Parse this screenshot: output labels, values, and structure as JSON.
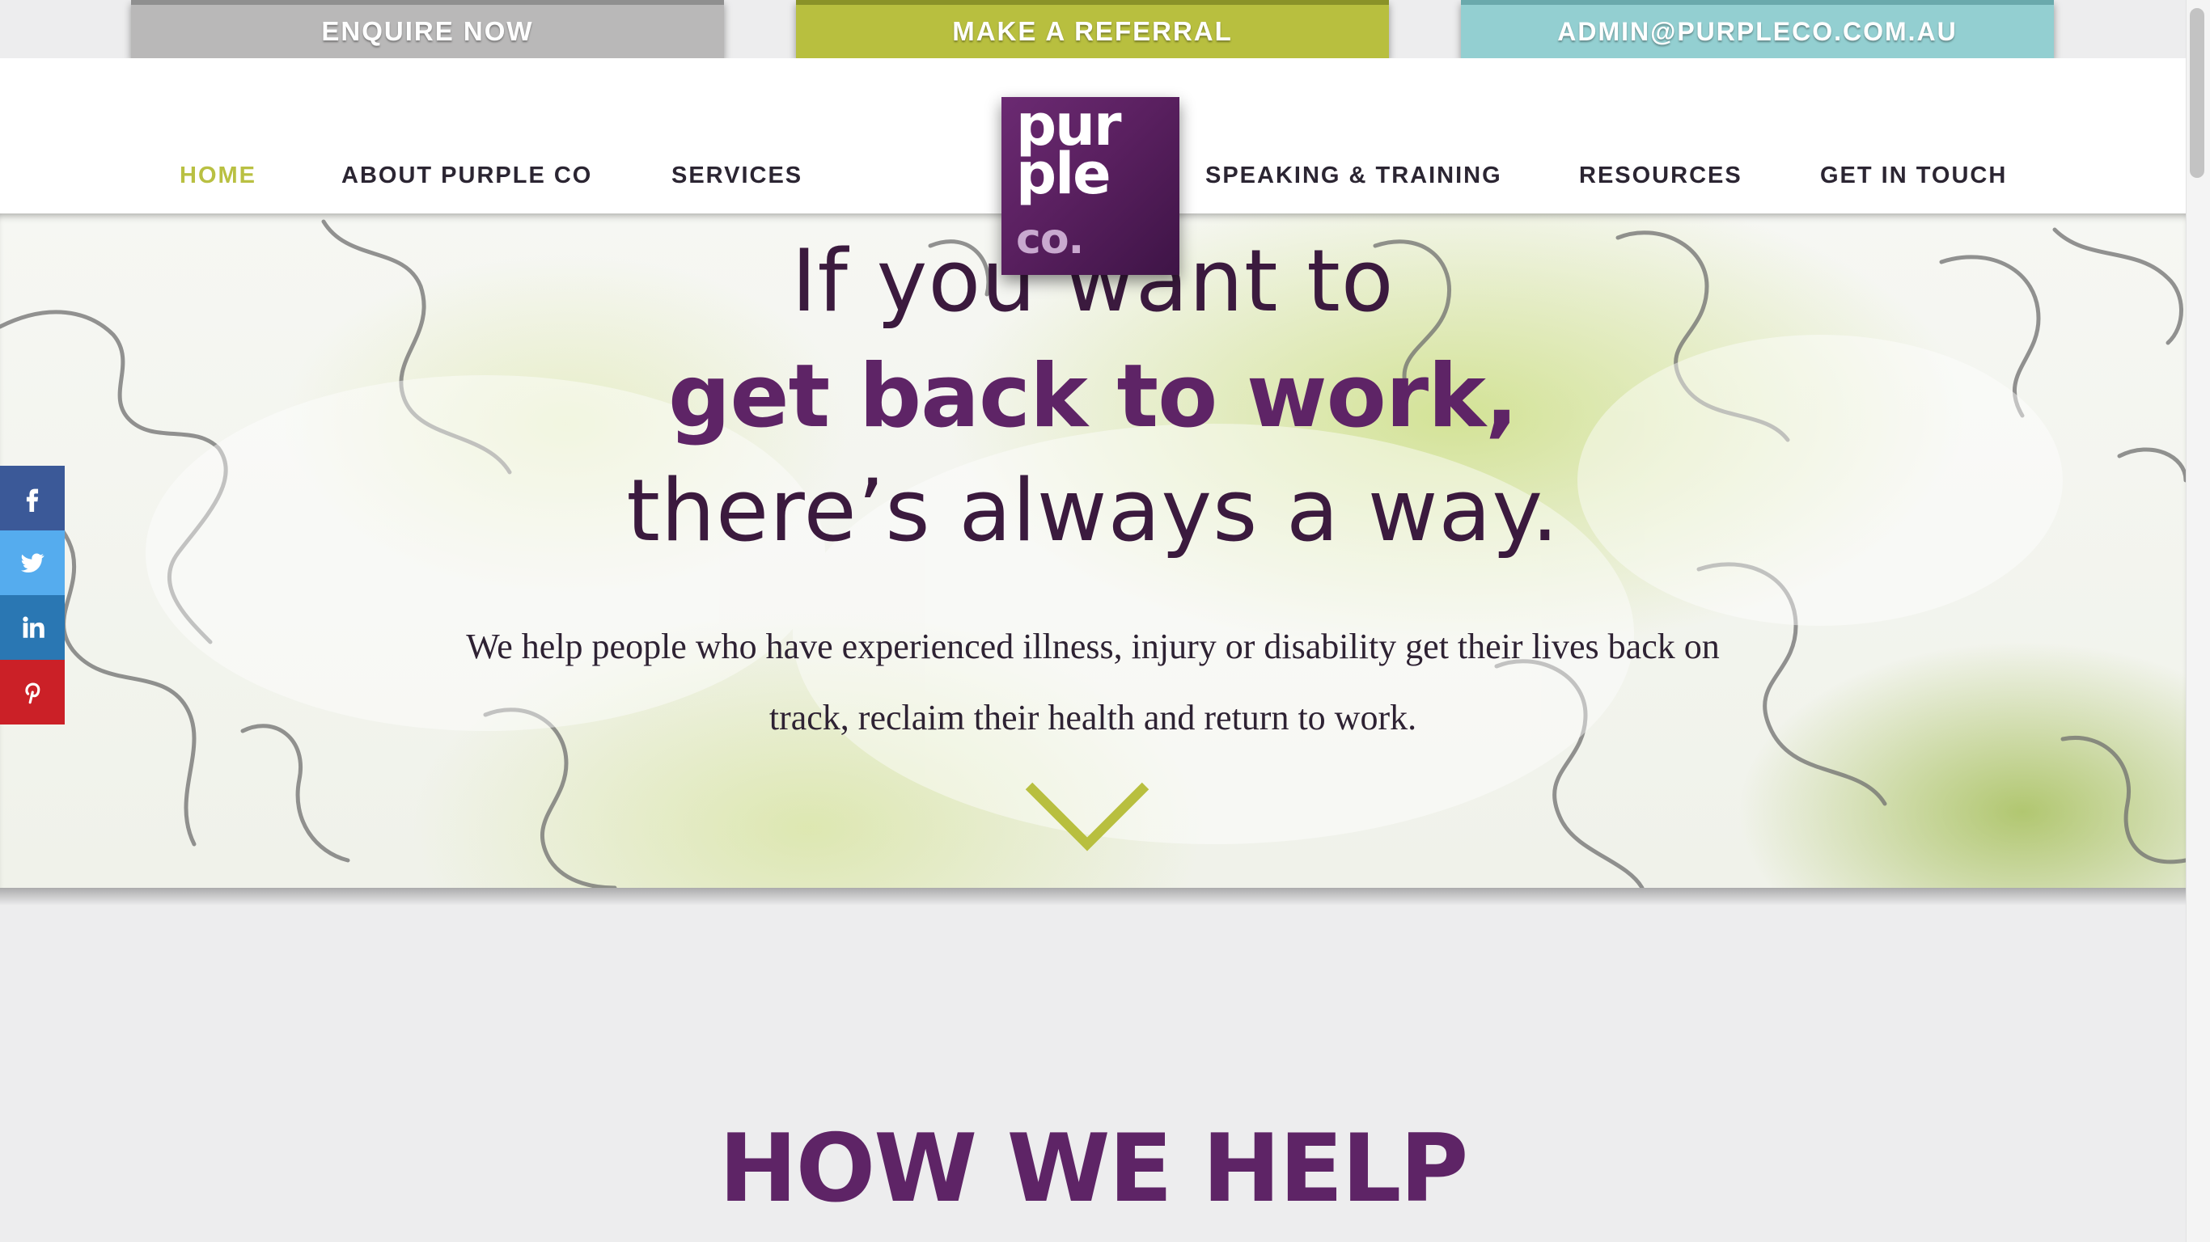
{
  "cta_buttons": {
    "enquire": "ENQUIRE NOW",
    "referral": "MAKE A REFERRAL",
    "email": "ADMIN@PURPLECO.COM.AU"
  },
  "nav": {
    "home": "HOME",
    "about": "ABOUT PURPLE CO",
    "services": "SERVICES",
    "speaking": "SPEAKING & TRAINING",
    "resources": "RESOURCES",
    "contact": "GET IN TOUCH",
    "active": "HOME"
  },
  "logo": {
    "line1": "pur",
    "line2": "ple",
    "line3": "co."
  },
  "hero": {
    "line1": "If you want to",
    "line2": "get back to work,",
    "line3": "there’s always a way.",
    "subtitle": "We help people who have experienced illness, injury or disability get their lives back on track, reclaim their health and return to work."
  },
  "social": {
    "facebook_icon": "facebook-icon",
    "twitter_icon": "twitter-icon",
    "linkedin_icon": "linkedin-icon",
    "pinterest_icon": "pinterest-icon"
  },
  "section": {
    "title": "HOW WE HELP"
  },
  "colors": {
    "brand_purple": "#5e2466",
    "accent_green": "#b8bf3f",
    "accent_teal": "#93cfd1",
    "grey_button": "#b9b8b8"
  }
}
